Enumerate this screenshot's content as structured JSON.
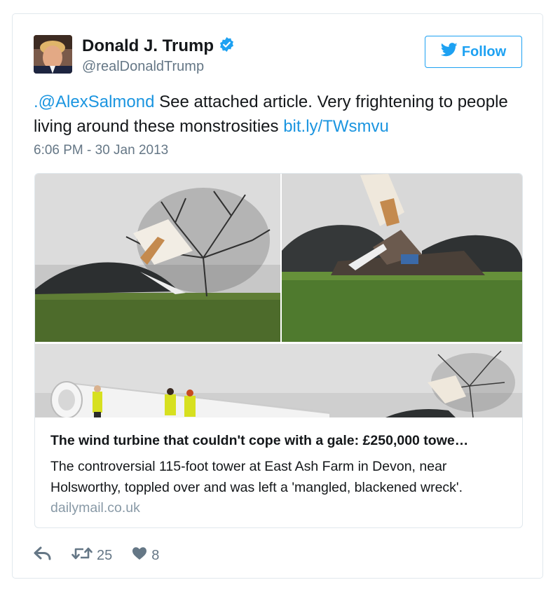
{
  "tweet": {
    "author_name": "Donald J. Trump",
    "author_handle": "@realDonaldTrump",
    "follow_label": "Follow",
    "text_mention": ".@AlexSalmond",
    "text_body": " See attached article. Very frightening to people living around these monstrosities ",
    "text_link": "bit.ly/TWsmvu",
    "timestamp": "6:06 PM - 30 Jan 2013"
  },
  "link_card": {
    "title": "The wind turbine that couldn't cope with a gale: £250,000 towe…",
    "description": "The controversial 115-foot tower at East Ash Farm in Devon, near Holsworthy, toppled over and was left a 'mangled, blackened wreck'.",
    "domain": "dailymail.co.uk"
  },
  "actions": {
    "retweet_count": "25",
    "like_count": "8"
  },
  "icons": {
    "verified": "verified-badge-icon",
    "follow": "twitter-bird-icon",
    "reply": "reply-icon",
    "retweet": "retweet-icon",
    "like": "heart-icon"
  },
  "colors": {
    "link": "#1b95e0",
    "follow": "#1da1f2",
    "muted": "#657786"
  }
}
